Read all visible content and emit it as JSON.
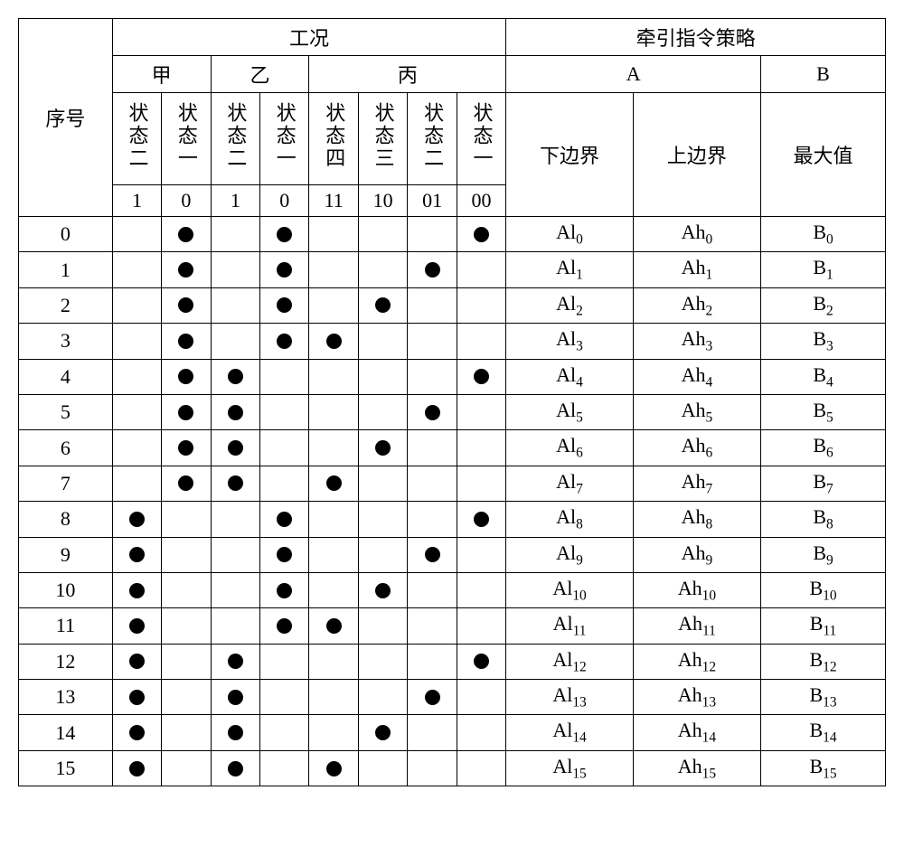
{
  "headers": {
    "seq": "序号",
    "gongkuang": "工况",
    "strategy": "牵引指令策略",
    "jia": "甲",
    "yi": "乙",
    "bing": "丙",
    "A": "A",
    "B": "B",
    "state_two": "状态二",
    "state_one": "状态一",
    "state_four": "状态四",
    "state_three": "状态三",
    "jia_s2_code": "1",
    "jia_s1_code": "0",
    "yi_s2_code": "1",
    "yi_s1_code": "0",
    "bing_s4_code": "11",
    "bing_s3_code": "10",
    "bing_s2_code": "01",
    "bing_s1_code": "00",
    "lower": "下边界",
    "upper": "上边界",
    "max": "最大值"
  },
  "rows": [
    {
      "seq": "0",
      "jia_s2": false,
      "jia_s1": true,
      "yi_s2": false,
      "yi_s1": true,
      "bing_s4": false,
      "bing_s3": false,
      "bing_s2": false,
      "bing_s1": true,
      "al": "Al",
      "al_i": "0",
      "ah": "Ah",
      "ah_i": "0",
      "b": "B",
      "b_i": "0"
    },
    {
      "seq": "1",
      "jia_s2": false,
      "jia_s1": true,
      "yi_s2": false,
      "yi_s1": true,
      "bing_s4": false,
      "bing_s3": false,
      "bing_s2": true,
      "bing_s1": false,
      "al": "Al",
      "al_i": "1",
      "ah": "Ah",
      "ah_i": "1",
      "b": "B",
      "b_i": "1"
    },
    {
      "seq": "2",
      "jia_s2": false,
      "jia_s1": true,
      "yi_s2": false,
      "yi_s1": true,
      "bing_s4": false,
      "bing_s3": true,
      "bing_s2": false,
      "bing_s1": false,
      "al": "Al",
      "al_i": "2",
      "ah": "Ah",
      "ah_i": "2",
      "b": "B",
      "b_i": "2"
    },
    {
      "seq": "3",
      "jia_s2": false,
      "jia_s1": true,
      "yi_s2": false,
      "yi_s1": true,
      "bing_s4": true,
      "bing_s3": false,
      "bing_s2": false,
      "bing_s1": false,
      "al": "Al",
      "al_i": "3",
      "ah": "Ah",
      "ah_i": "3",
      "b": "B",
      "b_i": "3"
    },
    {
      "seq": "4",
      "jia_s2": false,
      "jia_s1": true,
      "yi_s2": true,
      "yi_s1": false,
      "bing_s4": false,
      "bing_s3": false,
      "bing_s2": false,
      "bing_s1": true,
      "al": "Al",
      "al_i": "4",
      "ah": "Ah",
      "ah_i": "4",
      "b": "B",
      "b_i": "4"
    },
    {
      "seq": "5",
      "jia_s2": false,
      "jia_s1": true,
      "yi_s2": true,
      "yi_s1": false,
      "bing_s4": false,
      "bing_s3": false,
      "bing_s2": true,
      "bing_s1": false,
      "al": "Al",
      "al_i": "5",
      "ah": "Ah",
      "ah_i": "5",
      "b": "B",
      "b_i": "5"
    },
    {
      "seq": "6",
      "jia_s2": false,
      "jia_s1": true,
      "yi_s2": true,
      "yi_s1": false,
      "bing_s4": false,
      "bing_s3": true,
      "bing_s2": false,
      "bing_s1": false,
      "al": "Al",
      "al_i": "6",
      "ah": "Ah",
      "ah_i": "6",
      "b": "B",
      "b_i": "6"
    },
    {
      "seq": "7",
      "jia_s2": false,
      "jia_s1": true,
      "yi_s2": true,
      "yi_s1": false,
      "bing_s4": true,
      "bing_s3": false,
      "bing_s2": false,
      "bing_s1": false,
      "al": "Al",
      "al_i": "7",
      "ah": "Ah",
      "ah_i": "7",
      "b": "B",
      "b_i": "7"
    },
    {
      "seq": "8",
      "jia_s2": true,
      "jia_s1": false,
      "yi_s2": false,
      "yi_s1": true,
      "bing_s4": false,
      "bing_s3": false,
      "bing_s2": false,
      "bing_s1": true,
      "al": "Al",
      "al_i": "8",
      "ah": "Ah",
      "ah_i": "8",
      "b": "B",
      "b_i": "8"
    },
    {
      "seq": "9",
      "jia_s2": true,
      "jia_s1": false,
      "yi_s2": false,
      "yi_s1": true,
      "bing_s4": false,
      "bing_s3": false,
      "bing_s2": true,
      "bing_s1": false,
      "al": "Al",
      "al_i": "9",
      "ah": "Ah",
      "ah_i": "9",
      "b": "B",
      "b_i": "9"
    },
    {
      "seq": "10",
      "jia_s2": true,
      "jia_s1": false,
      "yi_s2": false,
      "yi_s1": true,
      "bing_s4": false,
      "bing_s3": true,
      "bing_s2": false,
      "bing_s1": false,
      "al": "Al",
      "al_i": "10",
      "ah": "Ah",
      "ah_i": "10",
      "b": "B",
      "b_i": "10"
    },
    {
      "seq": "11",
      "jia_s2": true,
      "jia_s1": false,
      "yi_s2": false,
      "yi_s1": true,
      "bing_s4": true,
      "bing_s3": false,
      "bing_s2": false,
      "bing_s1": false,
      "al": "Al",
      "al_i": "11",
      "ah": "Ah",
      "ah_i": "11",
      "b": "B",
      "b_i": "11"
    },
    {
      "seq": "12",
      "jia_s2": true,
      "jia_s1": false,
      "yi_s2": true,
      "yi_s1": false,
      "bing_s4": false,
      "bing_s3": false,
      "bing_s2": false,
      "bing_s1": true,
      "al": "Al",
      "al_i": "12",
      "ah": "Ah",
      "ah_i": "12",
      "b": "B",
      "b_i": "12"
    },
    {
      "seq": "13",
      "jia_s2": true,
      "jia_s1": false,
      "yi_s2": true,
      "yi_s1": false,
      "bing_s4": false,
      "bing_s3": false,
      "bing_s2": true,
      "bing_s1": false,
      "al": "Al",
      "al_i": "13",
      "ah": "Ah",
      "ah_i": "13",
      "b": "B",
      "b_i": "13"
    },
    {
      "seq": "14",
      "jia_s2": true,
      "jia_s1": false,
      "yi_s2": true,
      "yi_s1": false,
      "bing_s4": false,
      "bing_s3": true,
      "bing_s2": false,
      "bing_s1": false,
      "al": "Al",
      "al_i": "14",
      "ah": "Ah",
      "ah_i": "14",
      "b": "B",
      "b_i": "14"
    },
    {
      "seq": "15",
      "jia_s2": true,
      "jia_s1": false,
      "yi_s2": true,
      "yi_s1": false,
      "bing_s4": true,
      "bing_s3": false,
      "bing_s2": false,
      "bing_s1": false,
      "al": "Al",
      "al_i": "15",
      "ah": "Ah",
      "ah_i": "15",
      "b": "B",
      "b_i": "15"
    }
  ]
}
